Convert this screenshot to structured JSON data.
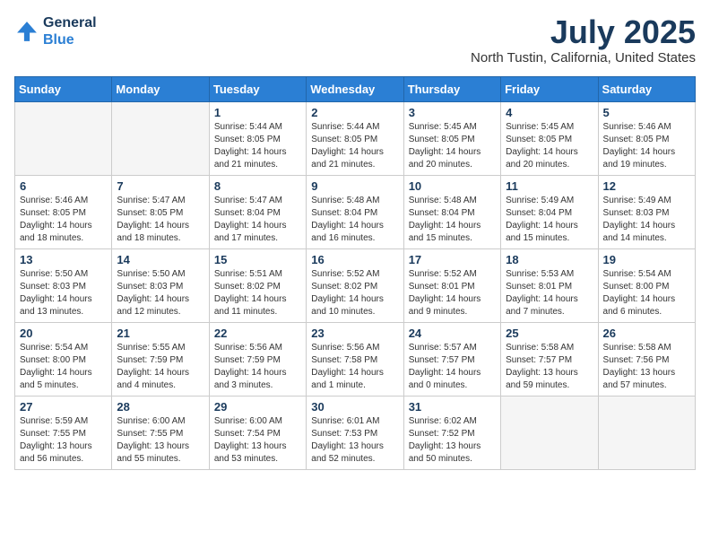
{
  "header": {
    "logo_line1": "General",
    "logo_line2": "Blue",
    "month_year": "July 2025",
    "location": "North Tustin, California, United States"
  },
  "weekdays": [
    "Sunday",
    "Monday",
    "Tuesday",
    "Wednesday",
    "Thursday",
    "Friday",
    "Saturday"
  ],
  "weeks": [
    [
      {
        "day": "",
        "content": ""
      },
      {
        "day": "",
        "content": ""
      },
      {
        "day": "1",
        "content": "Sunrise: 5:44 AM\nSunset: 8:05 PM\nDaylight: 14 hours and 21 minutes."
      },
      {
        "day": "2",
        "content": "Sunrise: 5:44 AM\nSunset: 8:05 PM\nDaylight: 14 hours and 21 minutes."
      },
      {
        "day": "3",
        "content": "Sunrise: 5:45 AM\nSunset: 8:05 PM\nDaylight: 14 hours and 20 minutes."
      },
      {
        "day": "4",
        "content": "Sunrise: 5:45 AM\nSunset: 8:05 PM\nDaylight: 14 hours and 20 minutes."
      },
      {
        "day": "5",
        "content": "Sunrise: 5:46 AM\nSunset: 8:05 PM\nDaylight: 14 hours and 19 minutes."
      }
    ],
    [
      {
        "day": "6",
        "content": "Sunrise: 5:46 AM\nSunset: 8:05 PM\nDaylight: 14 hours and 18 minutes."
      },
      {
        "day": "7",
        "content": "Sunrise: 5:47 AM\nSunset: 8:05 PM\nDaylight: 14 hours and 18 minutes."
      },
      {
        "day": "8",
        "content": "Sunrise: 5:47 AM\nSunset: 8:04 PM\nDaylight: 14 hours and 17 minutes."
      },
      {
        "day": "9",
        "content": "Sunrise: 5:48 AM\nSunset: 8:04 PM\nDaylight: 14 hours and 16 minutes."
      },
      {
        "day": "10",
        "content": "Sunrise: 5:48 AM\nSunset: 8:04 PM\nDaylight: 14 hours and 15 minutes."
      },
      {
        "day": "11",
        "content": "Sunrise: 5:49 AM\nSunset: 8:04 PM\nDaylight: 14 hours and 15 minutes."
      },
      {
        "day": "12",
        "content": "Sunrise: 5:49 AM\nSunset: 8:03 PM\nDaylight: 14 hours and 14 minutes."
      }
    ],
    [
      {
        "day": "13",
        "content": "Sunrise: 5:50 AM\nSunset: 8:03 PM\nDaylight: 14 hours and 13 minutes."
      },
      {
        "day": "14",
        "content": "Sunrise: 5:50 AM\nSunset: 8:03 PM\nDaylight: 14 hours and 12 minutes."
      },
      {
        "day": "15",
        "content": "Sunrise: 5:51 AM\nSunset: 8:02 PM\nDaylight: 14 hours and 11 minutes."
      },
      {
        "day": "16",
        "content": "Sunrise: 5:52 AM\nSunset: 8:02 PM\nDaylight: 14 hours and 10 minutes."
      },
      {
        "day": "17",
        "content": "Sunrise: 5:52 AM\nSunset: 8:01 PM\nDaylight: 14 hours and 9 minutes."
      },
      {
        "day": "18",
        "content": "Sunrise: 5:53 AM\nSunset: 8:01 PM\nDaylight: 14 hours and 7 minutes."
      },
      {
        "day": "19",
        "content": "Sunrise: 5:54 AM\nSunset: 8:00 PM\nDaylight: 14 hours and 6 minutes."
      }
    ],
    [
      {
        "day": "20",
        "content": "Sunrise: 5:54 AM\nSunset: 8:00 PM\nDaylight: 14 hours and 5 minutes."
      },
      {
        "day": "21",
        "content": "Sunrise: 5:55 AM\nSunset: 7:59 PM\nDaylight: 14 hours and 4 minutes."
      },
      {
        "day": "22",
        "content": "Sunrise: 5:56 AM\nSunset: 7:59 PM\nDaylight: 14 hours and 3 minutes."
      },
      {
        "day": "23",
        "content": "Sunrise: 5:56 AM\nSunset: 7:58 PM\nDaylight: 14 hours and 1 minute."
      },
      {
        "day": "24",
        "content": "Sunrise: 5:57 AM\nSunset: 7:57 PM\nDaylight: 14 hours and 0 minutes."
      },
      {
        "day": "25",
        "content": "Sunrise: 5:58 AM\nSunset: 7:57 PM\nDaylight: 13 hours and 59 minutes."
      },
      {
        "day": "26",
        "content": "Sunrise: 5:58 AM\nSunset: 7:56 PM\nDaylight: 13 hours and 57 minutes."
      }
    ],
    [
      {
        "day": "27",
        "content": "Sunrise: 5:59 AM\nSunset: 7:55 PM\nDaylight: 13 hours and 56 minutes."
      },
      {
        "day": "28",
        "content": "Sunrise: 6:00 AM\nSunset: 7:55 PM\nDaylight: 13 hours and 55 minutes."
      },
      {
        "day": "29",
        "content": "Sunrise: 6:00 AM\nSunset: 7:54 PM\nDaylight: 13 hours and 53 minutes."
      },
      {
        "day": "30",
        "content": "Sunrise: 6:01 AM\nSunset: 7:53 PM\nDaylight: 13 hours and 52 minutes."
      },
      {
        "day": "31",
        "content": "Sunrise: 6:02 AM\nSunset: 7:52 PM\nDaylight: 13 hours and 50 minutes."
      },
      {
        "day": "",
        "content": ""
      },
      {
        "day": "",
        "content": ""
      }
    ]
  ]
}
